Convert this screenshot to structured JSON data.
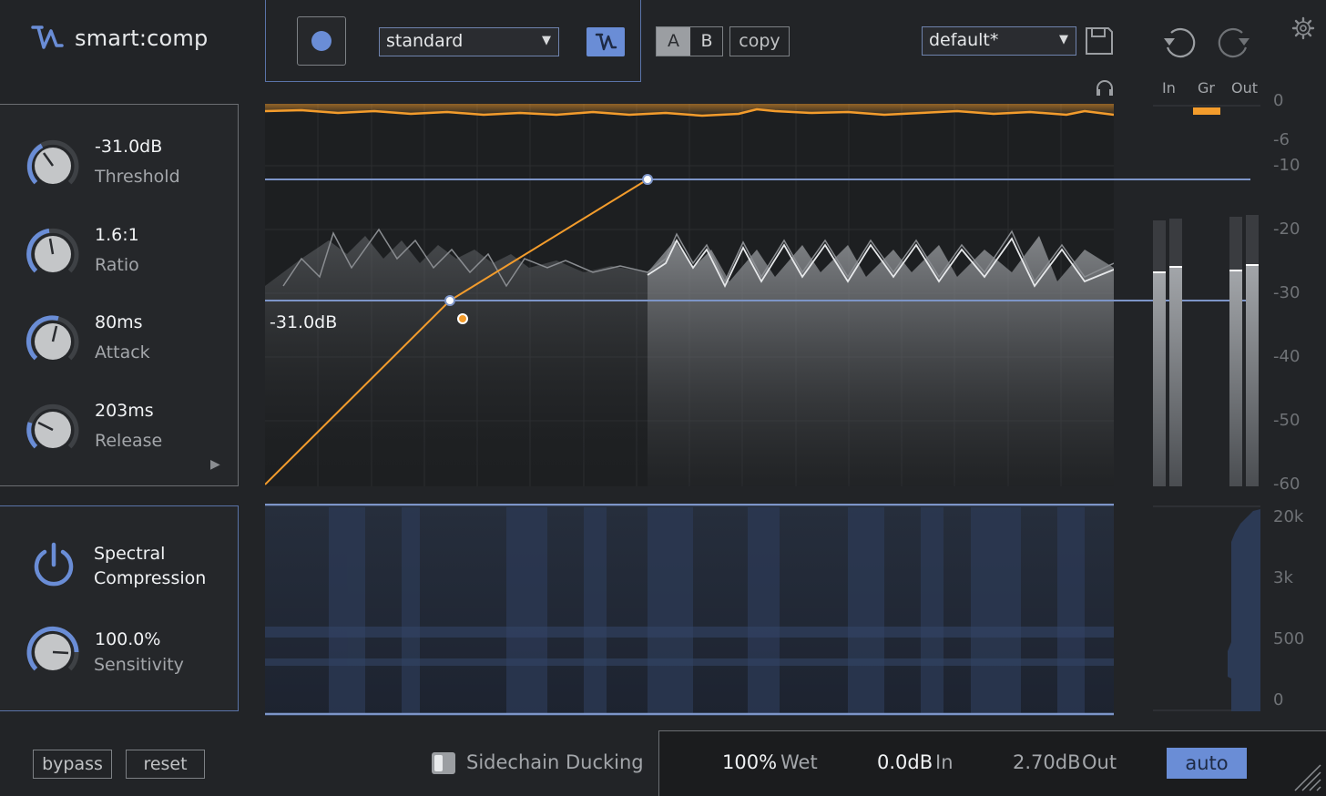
{
  "app": {
    "name": "smart:comp"
  },
  "header": {
    "mode_select": "standard",
    "ab": {
      "a": "A",
      "b": "B"
    },
    "copy_label": "copy",
    "preset_select": "default*"
  },
  "meters": {
    "in": "In",
    "gr": "Gr",
    "out": "Out"
  },
  "scale": {
    "db": [
      "0",
      "-6",
      "-10",
      "-20",
      "-30",
      "-40",
      "-50",
      "-60"
    ],
    "freq": [
      "20k",
      "3k",
      "500",
      "0"
    ]
  },
  "params": {
    "threshold": {
      "value": "-31.0dB",
      "label": "Threshold"
    },
    "ratio": {
      "value": "1.6:1",
      "label": "Ratio"
    },
    "attack": {
      "value": "80ms",
      "label": "Attack"
    },
    "release": {
      "value": "203ms",
      "label": "Release"
    }
  },
  "graph": {
    "threshold_label": "-31.0dB"
  },
  "spectral": {
    "title_line1": "Spectral",
    "title_line2": "Compression",
    "sensitivity": {
      "value": "100.0%",
      "label": "Sensitivity"
    }
  },
  "footer": {
    "bypass": "bypass",
    "reset": "reset",
    "sidechain": "Sidechain Ducking",
    "wet": {
      "value": "100%",
      "label": "Wet"
    },
    "in": {
      "value": "0.0dB",
      "label": "In"
    },
    "out": {
      "value": "2.70dB",
      "label": "Out"
    },
    "auto": "auto"
  },
  "colors": {
    "accent": "#6a8dd6",
    "curve": "#f39c2c",
    "panel": "#25272a"
  }
}
